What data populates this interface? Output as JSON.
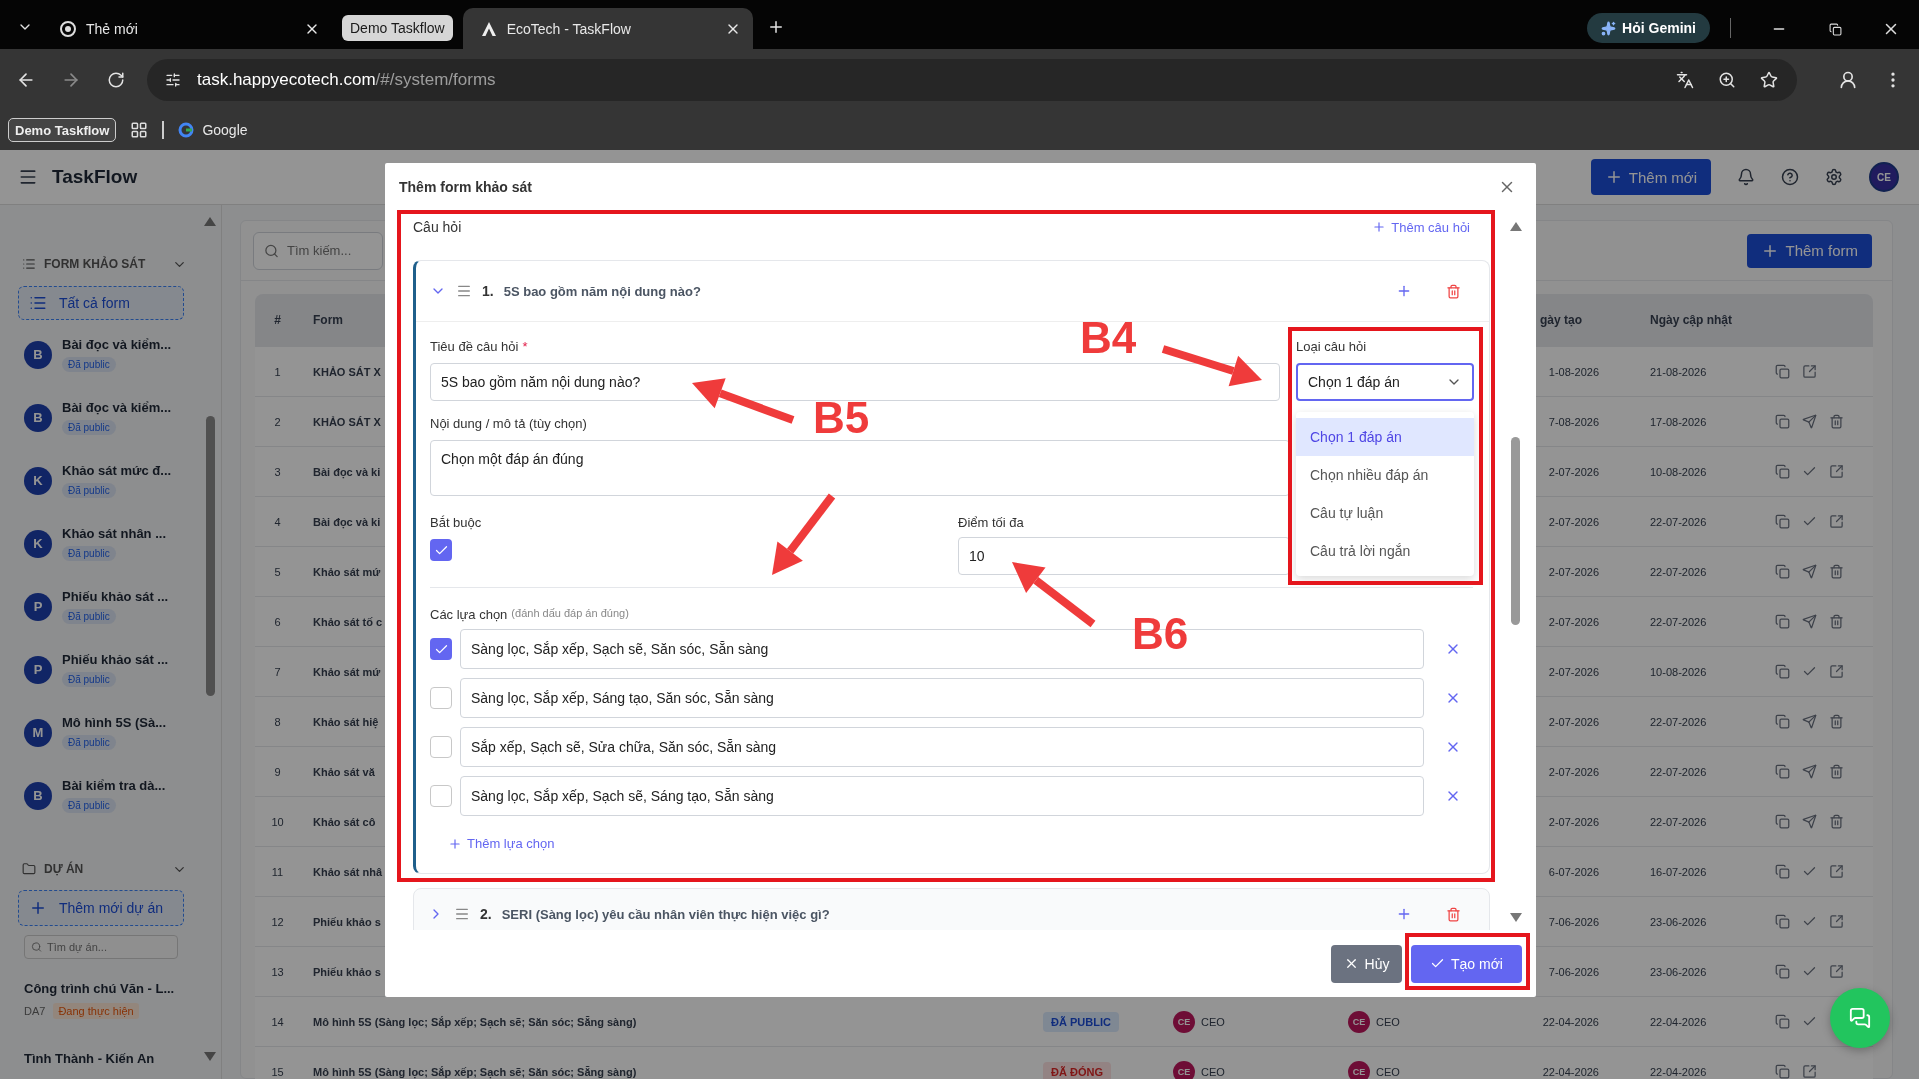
{
  "browser": {
    "tabs": [
      {
        "kind": "tab",
        "title": "Thẻ mới",
        "selected": false
      },
      {
        "kind": "group",
        "title": "Demo Taskflow",
        "selected": false
      },
      {
        "kind": "tab",
        "title": "EcoTech - TaskFlow",
        "selected": true
      }
    ],
    "gemini_button": "Hỏi Gemini",
    "url_host": "task.happyecotech.com",
    "url_path": "/#/system/forms",
    "bookmarks": [
      {
        "kind": "group",
        "label": "Demo Taskflow"
      },
      {
        "kind": "apps"
      },
      {
        "kind": "site",
        "label": "Google"
      }
    ]
  },
  "header": {
    "title": "TaskFlow",
    "add_button": "Thêm mới",
    "avatar": "CE"
  },
  "sidebar": {
    "forms_section": "FORM KHẢO SÁT",
    "all_forms": "Tất cả form",
    "forms": [
      {
        "initial": "B",
        "title": "Bài đọc và kiểm...",
        "badge": "Đã public"
      },
      {
        "initial": "B",
        "title": "Bài đọc và kiểm...",
        "badge": "Đã public"
      },
      {
        "initial": "K",
        "title": "Khảo sát mức đ...",
        "badge": "Đã public"
      },
      {
        "initial": "K",
        "title": "Khảo sát nhân ...",
        "badge": "Đã public"
      },
      {
        "initial": "P",
        "title": "Phiếu khảo sát ...",
        "badge": "Đã public"
      },
      {
        "initial": "P",
        "title": "Phiếu khảo sát ...",
        "badge": "Đã public"
      },
      {
        "initial": "M",
        "title": "Mô hình 5S (Sà...",
        "badge": "Đã public"
      },
      {
        "initial": "B",
        "title": "Bài kiểm tra dà...",
        "badge": "Đã public"
      }
    ],
    "projects_section": "DỰ ÁN",
    "add_project": "Thêm mới dự án",
    "project_search_placeholder": "Tìm dự án...",
    "projects": [
      {
        "name": "Công trình chú Văn - L...",
        "code": "DA7",
        "status": "Đang thực hiện"
      },
      {
        "name": "Tình Thành - Kiến An"
      }
    ]
  },
  "main": {
    "search_placeholder": "Tìm kiếm...",
    "add_form": "Thêm form",
    "columns": {
      "index": "#",
      "form": "Form",
      "created": "gày tạo",
      "updated": "Ngày cập nhật"
    },
    "rows": [
      {
        "index": "1",
        "form": "KHẢO SÁT X",
        "created": "1-08-2026",
        "updated": "21-08-2026",
        "actions": [
          {
            "kind": "copy"
          },
          {
            "kind": "external"
          }
        ]
      },
      {
        "index": "2",
        "form": "KHẢO SÁT X",
        "created": "7-08-2026",
        "updated": "17-08-2026",
        "actions": [
          {
            "kind": "copy"
          },
          {
            "kind": "send"
          },
          {
            "kind": "trash"
          }
        ]
      },
      {
        "index": "3",
        "form": "Bài đọc và ki",
        "created": "2-07-2026",
        "updated": "10-08-2026",
        "actions": [
          {
            "kind": "copy"
          },
          {
            "kind": "check"
          },
          {
            "kind": "external"
          }
        ]
      },
      {
        "index": "4",
        "form": "Bài đọc và ki",
        "created": "2-07-2026",
        "updated": "22-07-2026",
        "actions": [
          {
            "kind": "copy"
          },
          {
            "kind": "check"
          },
          {
            "kind": "external"
          }
        ]
      },
      {
        "index": "5",
        "form": "Khảo sát mứ",
        "created": "2-07-2026",
        "updated": "22-07-2026",
        "actions": [
          {
            "kind": "copy"
          },
          {
            "kind": "send"
          },
          {
            "kind": "trash"
          }
        ]
      },
      {
        "index": "6",
        "form": "Khảo sát tố c",
        "created": "2-07-2026",
        "updated": "22-07-2026",
        "actions": [
          {
            "kind": "copy"
          },
          {
            "kind": "send"
          },
          {
            "kind": "trash"
          }
        ]
      },
      {
        "index": "7",
        "form": "Khảo sát mứ",
        "created": "2-07-2026",
        "updated": "10-08-2026",
        "actions": [
          {
            "kind": "copy"
          },
          {
            "kind": "check"
          },
          {
            "kind": "external"
          }
        ]
      },
      {
        "index": "8",
        "form": "Khảo sát hiệ",
        "created": "2-07-2026",
        "updated": "22-07-2026",
        "actions": [
          {
            "kind": "copy"
          },
          {
            "kind": "send"
          },
          {
            "kind": "trash"
          }
        ]
      },
      {
        "index": "9",
        "form": "Khảo sát vă",
        "created": "2-07-2026",
        "updated": "22-07-2026",
        "actions": [
          {
            "kind": "copy"
          },
          {
            "kind": "send"
          },
          {
            "kind": "trash"
          }
        ]
      },
      {
        "index": "10",
        "form": "Khảo sát cô",
        "created": "2-07-2026",
        "updated": "22-07-2026",
        "actions": [
          {
            "kind": "copy"
          },
          {
            "kind": "send"
          },
          {
            "kind": "trash"
          }
        ]
      },
      {
        "index": "11",
        "form": "Khảo sát nhâ",
        "created": "6-07-2026",
        "updated": "16-07-2026",
        "actions": [
          {
            "kind": "copy"
          },
          {
            "kind": "check"
          },
          {
            "kind": "external"
          }
        ]
      },
      {
        "index": "12",
        "form": "Phiếu khảo s",
        "created": "7-06-2026",
        "updated": "23-06-2026",
        "actions": [
          {
            "kind": "copy"
          },
          {
            "kind": "check"
          },
          {
            "kind": "external"
          }
        ]
      },
      {
        "index": "13",
        "form": "Phiếu khảo s",
        "created": "7-06-2026",
        "updated": "23-06-2026",
        "actions": [
          {
            "kind": "copy"
          },
          {
            "kind": "check"
          },
          {
            "kind": "external"
          }
        ]
      },
      {
        "index": "14",
        "form": "Mô hình 5S (Sàng lọc; Sắp xếp; Sạch sẽ; Săn sóc; Sẵng sàng)",
        "status": {
          "kind": "public",
          "label": "ĐÃ PUBLIC"
        },
        "creator": {
          "initials": "CE",
          "name": "CEO"
        },
        "updater": {
          "initials": "CE",
          "name": "CEO"
        },
        "created": "22-04-2026",
        "updated": "22-04-2026",
        "actions": [
          {
            "kind": "copy"
          },
          {
            "kind": "check"
          }
        ]
      },
      {
        "index": "15",
        "form": "Mô hình 5S (Sàng lọc; Sắp xếp; Sạch sẽ; Săn sóc; Sẵng sàng)",
        "status": {
          "kind": "closed",
          "label": "ĐÃ ĐÓNG"
        },
        "creator": {
          "initials": "CE",
          "name": "CEO"
        },
        "updater": {
          "initials": "CE",
          "name": "CEO"
        },
        "created": "22-04-2026",
        "updated": "22-04-2026",
        "actions": [
          {
            "kind": "copy"
          },
          {
            "kind": "external"
          }
        ]
      }
    ]
  },
  "modal": {
    "title": "Thêm form khảo sát",
    "section_label": "Câu hỏi",
    "add_question": "Thêm câu hỏi",
    "questions": [
      {
        "number": "1.",
        "title": "5S bao gồm năm nội dung nào?",
        "expanded": true,
        "title_label": "Tiêu đề câu hỏi",
        "required_mark": "*",
        "title_value": "5S bao gồm năm nội dung nào?",
        "description_label": "Nội dung / mô tả (tùy chọn)",
        "description_value": "Chọn một đáp án đúng",
        "required_label": "Bắt buộc",
        "required": true,
        "max_score_label": "Điểm tối đa",
        "max_score": "10",
        "type_label": "Loại câu hỏi",
        "type_value": "Chọn 1 đáp án",
        "type_expanded": true,
        "type_options": [
          {
            "label": "Chọn 1 đáp án",
            "selected": true
          },
          {
            "label": "Chọn nhiều đáp án",
            "selected": false
          },
          {
            "label": "Câu tự luận",
            "selected": false
          },
          {
            "label": "Câu trả lời ngắn",
            "selected": false
          }
        ],
        "choices_label": "Các lựa chọn",
        "choices_hint": "(đánh dấu đáp án đúng)",
        "choices": [
          {
            "text": "Sàng lọc, Sắp xếp, Sạch sẽ, Săn sóc, Sẵn sàng",
            "correct": true
          },
          {
            "text": "Sàng lọc, Sắp xếp, Sáng tạo, Săn sóc, Sẵn sàng",
            "correct": false
          },
          {
            "text": "Sắp xếp, Sạch sẽ, Sửa chữa, Săn sóc, Sẵn sàng",
            "correct": false
          },
          {
            "text": "Sàng lọc, Sắp xếp, Sạch sẽ, Sáng tạo, Sẵn sàng",
            "correct": false
          }
        ],
        "add_choice": "Thêm lựa chọn"
      },
      {
        "number": "2.",
        "title": "SERI (Sàng lọc) yêu cầu nhân viên thực hiện việc gì?",
        "expanded": false
      }
    ],
    "cancel": "Hủy",
    "submit": "Tạo mới"
  },
  "annotations": [
    {
      "label": "B4"
    },
    {
      "label": "B5"
    },
    {
      "label": "B6"
    }
  ]
}
